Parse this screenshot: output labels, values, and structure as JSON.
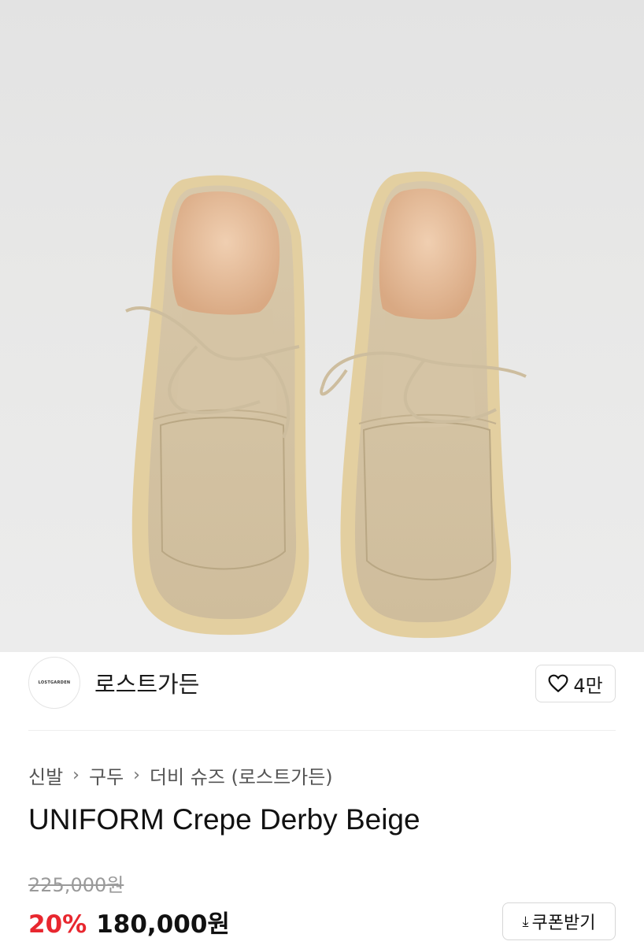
{
  "colors": {
    "hero_background": "#e6e6e6",
    "suede": "#d9c9ac",
    "sole": "#e2cfa0",
    "lining": "#e6c0a0",
    "discount": "#e8272f"
  },
  "brand": {
    "logo_text": "LOSTGARDEN",
    "name": "로스트가든",
    "like_icon": "heart-icon",
    "like_count": "4만"
  },
  "breadcrumb": {
    "items": [
      "신발",
      "구두",
      "더비 슈즈 (로스트가든)"
    ],
    "separator_icon": "chevron-right-icon"
  },
  "product": {
    "title": "UNIFORM Crepe Derby Beige",
    "original_price": "225,000원",
    "discount": "20%",
    "price": "180,000원"
  },
  "coupon": {
    "icon": "download-icon",
    "label": "쿠폰받기"
  }
}
